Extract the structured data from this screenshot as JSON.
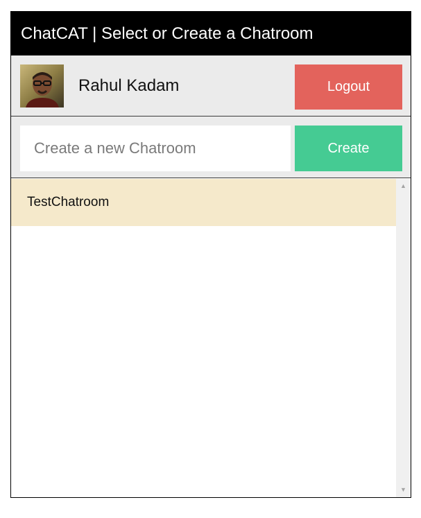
{
  "header": {
    "title": "ChatCAT | Select or Create a Chatroom"
  },
  "user": {
    "name": "Rahul Kadam",
    "logout_label": "Logout"
  },
  "create": {
    "placeholder": "Create a new Chatroom",
    "value": "",
    "button_label": "Create"
  },
  "rooms": [
    {
      "name": "TestChatroom"
    }
  ],
  "scrollbar": {
    "up_icon": "▲",
    "down_icon": "▼"
  },
  "colors": {
    "header_bg": "#000000",
    "bar_bg": "#ebebeb",
    "logout": "#e3635c",
    "create": "#45cb93",
    "room_bg": "#f5e9cb"
  }
}
